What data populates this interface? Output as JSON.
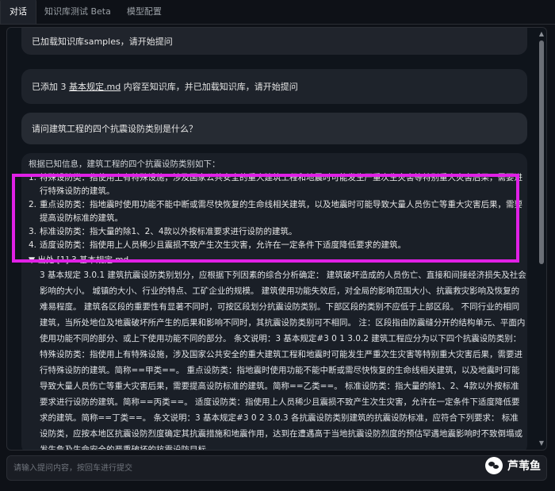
{
  "tabs": [
    {
      "label": "对话"
    },
    {
      "label": "知识库测试 Beta"
    },
    {
      "label": "模型配置"
    }
  ],
  "messages": {
    "m1": "已加载知识库samples，请开始提问",
    "m2_pre": "已添加 3 ",
    "m2_link": "基本规定.md",
    "m2_post": " 内容至知识库，并已加载知识库，请开始提问",
    "m3": "请问建筑工程的四个抗震设防类别是什么？"
  },
  "answer": {
    "intro": "根据已知信息，建筑工程的四个抗震设防类别如下：",
    "items": [
      {
        "num": "1.",
        "text": "特殊设防类：指使用上有特殊设施，涉及国家公共安全的重大建筑工程和地震时可能发生严重次生灾害等特别重大灾害后果，需要进行特殊设防的建筑。"
      },
      {
        "num": "2.",
        "text": "重点设防类：指地震时使用功能不能中断或需尽快恢复的生命线相关建筑，以及地震时可能导致大量人员伤亡等重大灾害后果，需要提高设防标准的建筑。"
      },
      {
        "num": "3.",
        "text": "标准设防类：指大量的除1、2、4款以外按标准要求进行设防的建筑。"
      },
      {
        "num": "4.",
        "text": "适度设防类：指使用上人员稀少且震损不致产生次生灾害，允许在一定条件下适度降低要求的建筑。"
      }
    ],
    "source_title": "▼ 出处 [1] 3 基本规定.md",
    "source_text": "3 基本规定 3.0.1 建筑抗震设防类别划分，应根据下列因素的综合分析确定： 建筑破坏造成的人员伤亡、直接和间接经济损失及社会影响的大小。 城镇的大小、行业的特点、工矿企业的规模。 建筑使用功能失效后，对全局的影响范围大小、抗震救灾影响及恢复的难易程度。 建筑各区段的重要性有显著不同时，可按区段划分抗震设防类别。下部区段的类别不应低于上部区段。 不同行业的相同建筑，当所处地位及地震破坏所产生的后果和影响不同时，其抗震设防类别可不相同。 注：区段指由防震缝分开的结构单元、平面内使用功能不同的部分、或上下使用功能不同的部分。 条文说明：3 基本规定#3 0 1 3.0.2 建筑工程应分为以下四个抗震设防类别： 特殊设防类：指使用上有特殊设施，涉及国家公共安全的重大建筑工程和地震时可能发生严重次生灾害等特别重大灾害后果，需要进行特殊设防的建筑。简称==甲类==。 重点设防类：指地震时使用功能不能中断或需尽快恢复的生命线相关建筑，以及地震时可能导致大量人员伤亡等重大灾害后果，需要提高设防标准的建筑。简称==乙类==。 标准设防类：指大量的除1、2、4款以外按标准要求进行设防的建筑。简称==丙类==。 适度设防类：指使用上人员稀少且震损不致产生次生灾害，允许在一定条件下适度降低要求的建筑。简称==丁类==。 条文说明：3 基本规定#3 0 2 3.0.3 各抗震设防类别建筑的抗震设防标准，应符合下列要求： 标准设防类，应按本地区抗震设防烈度确定其抗震措施和地震作用，达到在遭遇高于当地抗震设防烈度的预估罕遇地震影响时不致倒塌或发生危及生命安全的严重破坏的抗震设防目标。"
  },
  "input": {
    "placeholder": "请输入提问内容，按回车进行提交"
  },
  "watermark": {
    "text": "芦苇鱼"
  },
  "colors": {
    "highlight_border": "#e020e6",
    "background": "#0e1117"
  }
}
